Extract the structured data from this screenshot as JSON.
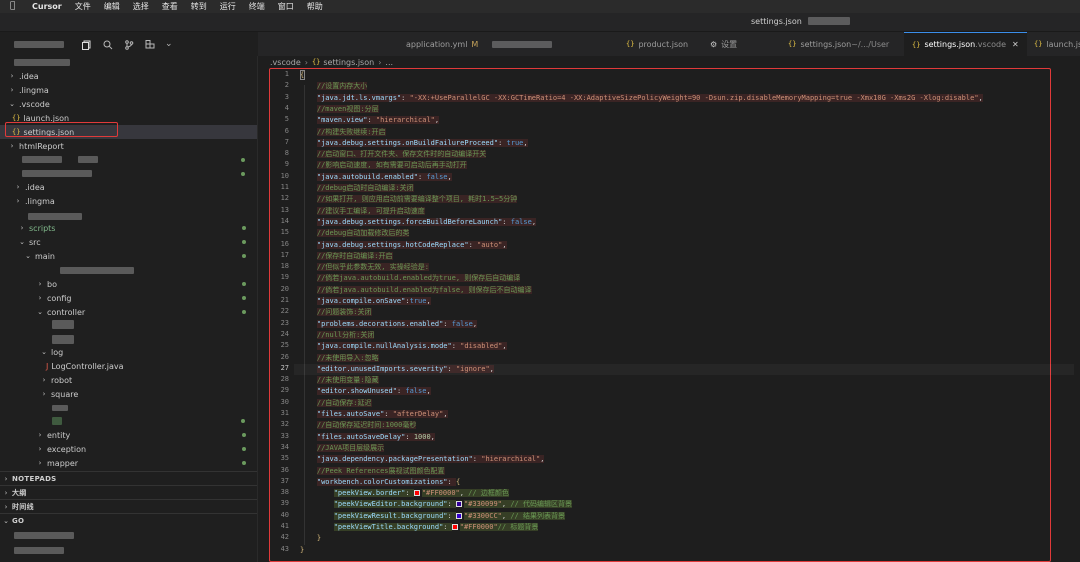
{
  "menubar": {
    "app": "Cursor",
    "items": [
      "文件",
      "编辑",
      "选择",
      "查看",
      "转到",
      "运行",
      "终端",
      "窗口",
      "帮助"
    ]
  },
  "window": {
    "title": "settings.json"
  },
  "tabs": [
    {
      "label": "application.yml",
      "badge": "M"
    },
    {
      "label": "product.json"
    },
    {
      "label": "设置"
    },
    {
      "label": "settings.json",
      "sub": " ~/.../User"
    },
    {
      "label": "settings.json",
      "sub": " .vscode",
      "active": true
    },
    {
      "label": "launch.json"
    }
  ],
  "breadcrumb": {
    "folder": ".vscode",
    "file": "settings.json",
    "tail": "..."
  },
  "explorer": {
    "rows": [
      {
        "label": ".idea",
        "depth": 1,
        "chev": "›"
      },
      {
        "label": ".lingma",
        "depth": 1,
        "chev": "›"
      },
      {
        "label": ".vscode",
        "depth": 1,
        "chev": "⌄"
      },
      {
        "label": "launch.json",
        "depth": 2,
        "icon": "json"
      },
      {
        "label": "settings.json",
        "depth": 2,
        "icon": "json",
        "selected": true
      },
      {
        "label": "htmlReport",
        "depth": 1,
        "chev": "›"
      },
      {
        "label": ".idea",
        "depth": 2,
        "chev": "›"
      },
      {
        "label": ".lingma",
        "depth": 2,
        "chev": "›"
      },
      {
        "label": "scripts",
        "depth": 3,
        "chev": "›"
      },
      {
        "label": "src",
        "depth": 3,
        "chev": "⌄"
      },
      {
        "label": "main",
        "depth": 4,
        "chev": "⌄"
      },
      {
        "label": "bo",
        "depth": 5,
        "chev": "›"
      },
      {
        "label": "config",
        "depth": 5,
        "chev": "›"
      },
      {
        "label": "controller",
        "depth": 5,
        "chev": "⌄"
      },
      {
        "label": "log",
        "depth": 6,
        "chev": "⌄"
      },
      {
        "label": "LogController.java",
        "depth": 7,
        "icon": "java"
      },
      {
        "label": "robot",
        "depth": 6,
        "chev": "›"
      },
      {
        "label": "square",
        "depth": 6,
        "chev": "›"
      },
      {
        "label": "entity",
        "depth": 5,
        "chev": "›"
      },
      {
        "label": "exception",
        "depth": 5,
        "chev": "›"
      },
      {
        "label": "mapper",
        "depth": 5,
        "chev": "›"
      }
    ],
    "panels": [
      "NOTEPADS",
      "大纲",
      "时间线",
      "GO"
    ]
  },
  "editor": {
    "current_line": 27,
    "lines": [
      "{",
      "    //设置内存大小",
      "    \"java.jdt.ls.vmargs\": \"-XX:+UseParallelGC -XX:GCTimeRatio=4 -XX:AdaptiveSizePolicyWeight=90 -Dsun.zip.disableMemoryMapping=true -Xmx10G -Xms2G -Xlog:disable\",",
      "    //maven视图:分层",
      "    \"maven.view\": \"hierarchical\",",
      "    //构建失败继续:开启",
      "    \"java.debug.settings.onBuildFailureProceed\": true,",
      "    //启动窗口、打开文件夹、保存文件时的自动编译开关",
      "    //影响启动速度, 如有需要可启动后再手动打开",
      "    \"java.autobuild.enabled\": false,",
      "    //debug启动时自动编译:关闭",
      "    //如果打开, 则应用启动前需要编译整个项目, 耗时1.5~5分钟",
      "    //建议手工编译, 可提升启动速度",
      "    \"java.debug.settings.forceBuildBeforeLaunch\": false,",
      "    //debug自动加载修改后的类",
      "    \"java.debug.settings.hotCodeReplace\": \"auto\",",
      "    //保存时自动编译:开启",
      "    //但似乎此参数无效, 实操经验是:",
      "    //倘若java.autobuild.enabled为true, 则保存后自动编译",
      "    //倘若java.autobuild.enabled为false, 则保存后不自动编译",
      "    \"java.compile.onSave\":true,",
      "    //问题装饰:关闭",
      "    \"problems.decorations.enabled\": false,",
      "    //null分析:关闭",
      "    \"java.compile.nullAnalysis.mode\": \"disabled\",",
      "    //未使用导入:忽略",
      "    \"editor.unusedImports.severity\": \"ignore\",",
      "    //未使用变量:隐藏",
      "    \"editor.showUnused\": false,",
      "    //自动保存:延迟",
      "    \"files.autoSave\": \"afterDelay\",",
      "    //自动保存延迟时间:1000毫秒",
      "    \"files.autoSaveDelay\": 1000,",
      "    //JAVA项目层级展示",
      "    \"java.dependency.packagePresentation\": \"hierarchical\",",
      "    //Peek References展视试图颜色配置",
      "    \"workbench.colorCustomizations\": {",
      "        \"peekView.border\": \"#FF0000\", // 边框颜色",
      "        \"peekViewEditor.background\": \"#330099\", // 代码编辑区背景",
      "        \"peekViewResult.background\": \"#3300CC\", // 结果列表背景",
      "        \"peekViewTitle.background\": \"#FF0000\"// 标题背景",
      "    }",
      "}"
    ]
  },
  "colors": {
    "accent": "#3b8eea",
    "annotation_red": "#e03a3a",
    "swatch_colors": [
      "#FF0000",
      "#330099",
      "#3300CC",
      "#FF0000"
    ]
  }
}
